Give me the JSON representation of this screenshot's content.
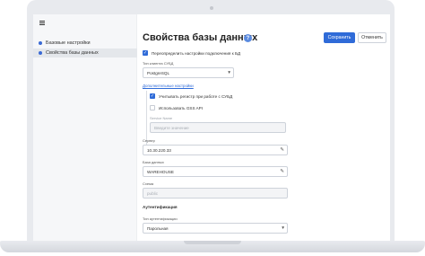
{
  "sidebar": {
    "items": [
      {
        "label": "Базовые настройки"
      },
      {
        "label": "Свойства базы данных"
      }
    ]
  },
  "page": {
    "title": "Свойства базы данных",
    "help_icon": "?",
    "save_label": "Сохранить",
    "cancel_label": "Отменить"
  },
  "form": {
    "override_checkbox": {
      "label": "Переопределить настройки подключения к БД",
      "checked": true
    },
    "db_client_type": {
      "label": "Тип клиента СУБД",
      "value": "PostgreSQL",
      "icon": "chevron-down-icon"
    },
    "advanced_link": "Дополнительные настройки",
    "case_checkbox": {
      "label": "Учитывать регистр при работе с СУБД",
      "checked": true
    },
    "gss_checkbox": {
      "label": "Использовать GSS API",
      "checked": false
    },
    "server_name": {
      "label": "Service Name",
      "placeholder": "Введите значение"
    },
    "server": {
      "label": "Сервер",
      "value": "10.30.220.33",
      "icon": "pencil-icon"
    },
    "database": {
      "label": "База данных",
      "value": "WAREHOUSE",
      "icon": "pencil-icon"
    },
    "schema": {
      "label": "Схема",
      "placeholder": "public"
    },
    "auth_section": "Аутентификация",
    "auth_type": {
      "label": "Тип аутентификации",
      "value": "Парольная",
      "icon": "chevron-down-icon"
    }
  }
}
